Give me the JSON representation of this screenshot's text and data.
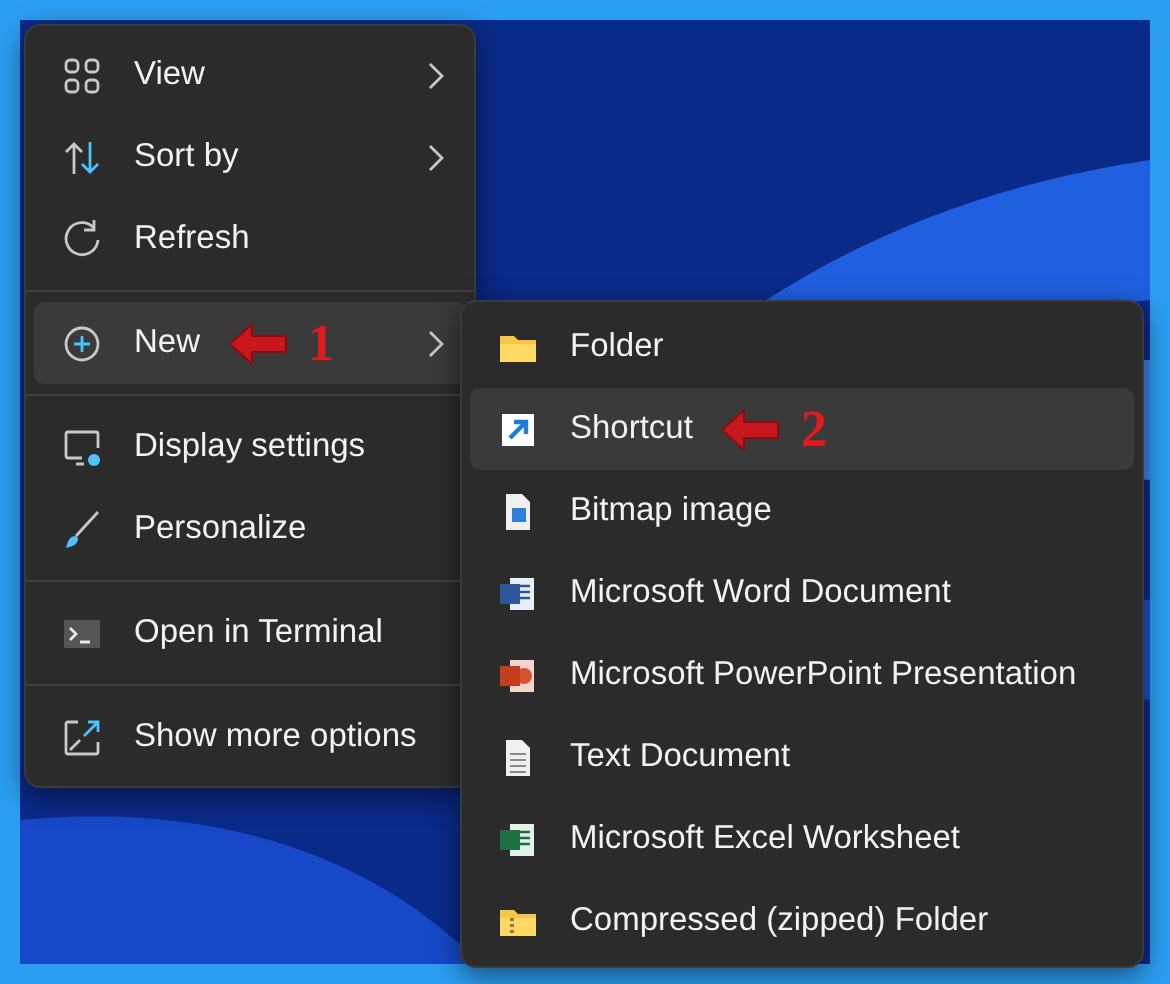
{
  "main_menu": {
    "groups": [
      {
        "items": [
          {
            "label": "View",
            "kind": "grid",
            "has_submenu": true,
            "selected": false
          },
          {
            "label": "Sort by",
            "kind": "sort",
            "has_submenu": true,
            "selected": false
          },
          {
            "label": "Refresh",
            "kind": "refresh",
            "has_submenu": false,
            "selected": false
          }
        ]
      },
      {
        "items": [
          {
            "label": "New",
            "kind": "plus",
            "has_submenu": true,
            "selected": true,
            "annotation": "1"
          }
        ]
      },
      {
        "items": [
          {
            "label": "Display settings",
            "kind": "display",
            "has_submenu": false,
            "selected": false
          },
          {
            "label": "Personalize",
            "kind": "brush",
            "has_submenu": false,
            "selected": false
          }
        ]
      },
      {
        "items": [
          {
            "label": "Open in Terminal",
            "kind": "terminal",
            "has_submenu": false,
            "selected": false
          }
        ]
      },
      {
        "items": [
          {
            "label": "Show more options",
            "kind": "expand",
            "has_submenu": false,
            "selected": false
          }
        ]
      }
    ]
  },
  "new_submenu": {
    "items": [
      {
        "label": "Folder",
        "kind": "folder",
        "selected": false
      },
      {
        "label": "Shortcut",
        "kind": "shortcut",
        "selected": true,
        "annotation": "2"
      },
      {
        "label": "Bitmap image",
        "kind": "bitmap",
        "selected": false
      },
      {
        "label": "Microsoft Word Document",
        "kind": "word",
        "selected": false
      },
      {
        "label": "Microsoft PowerPoint Presentation",
        "kind": "powerpoint",
        "selected": false
      },
      {
        "label": "Text Document",
        "kind": "text",
        "selected": false
      },
      {
        "label": "Microsoft Excel Worksheet",
        "kind": "excel",
        "selected": false
      },
      {
        "label": "Compressed (zipped) Folder",
        "kind": "zip",
        "selected": false
      }
    ]
  }
}
